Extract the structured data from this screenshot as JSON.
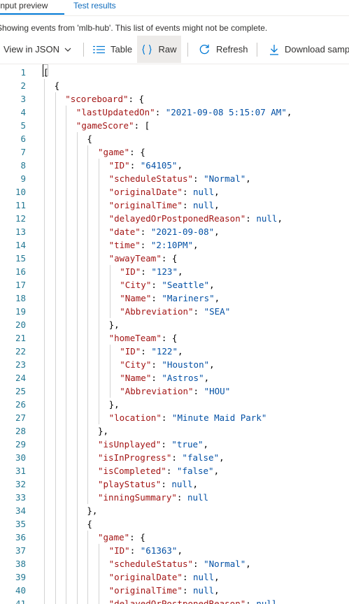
{
  "tabs": [
    {
      "label": "Input preview",
      "active": true
    },
    {
      "label": "Test results",
      "active": false
    }
  ],
  "notice": "Showing events from 'mlb-hub'. This list of events might not be complete.",
  "toolbar": {
    "view_label": "View in JSON",
    "table_label": "Table",
    "raw_label": "Raw",
    "refresh_label": "Refresh",
    "download_label": "Download samp"
  },
  "colors": {
    "accent": "#0078d4",
    "link": "#0f6cbd",
    "json_key": "#a31515",
    "json_value": "#0451a5",
    "line_number": "#237893"
  },
  "editor": {
    "lines": [
      {
        "n": "1",
        "indent": 0,
        "parts": [
          [
            "p",
            "["
          ]
        ]
      },
      {
        "n": "2",
        "indent": 1,
        "parts": [
          [
            "p",
            "{"
          ]
        ]
      },
      {
        "n": "3",
        "indent": 2,
        "parts": [
          [
            "k",
            "\"scoreboard\""
          ],
          [
            "p",
            ": {"
          ]
        ]
      },
      {
        "n": "4",
        "indent": 3,
        "parts": [
          [
            "k",
            "\"lastUpdatedOn\""
          ],
          [
            "p",
            ": "
          ],
          [
            "s",
            "\"2021-09-08 5:15:07 AM\""
          ],
          [
            "p",
            ","
          ]
        ]
      },
      {
        "n": "5",
        "indent": 3,
        "parts": [
          [
            "k",
            "\"gameScore\""
          ],
          [
            "p",
            ": ["
          ]
        ]
      },
      {
        "n": "6",
        "indent": 4,
        "parts": [
          [
            "p",
            "{"
          ]
        ]
      },
      {
        "n": "7",
        "indent": 5,
        "parts": [
          [
            "k",
            "\"game\""
          ],
          [
            "p",
            ": {"
          ]
        ]
      },
      {
        "n": "8",
        "indent": 6,
        "parts": [
          [
            "k",
            "\"ID\""
          ],
          [
            "p",
            ": "
          ],
          [
            "s",
            "\"64105\""
          ],
          [
            "p",
            ","
          ]
        ]
      },
      {
        "n": "9",
        "indent": 6,
        "parts": [
          [
            "k",
            "\"scheduleStatus\""
          ],
          [
            "p",
            ": "
          ],
          [
            "s",
            "\"Normal\""
          ],
          [
            "p",
            ","
          ]
        ]
      },
      {
        "n": "10",
        "indent": 6,
        "parts": [
          [
            "k",
            "\"originalDate\""
          ],
          [
            "p",
            ": "
          ],
          [
            "n",
            "null"
          ],
          [
            "p",
            ","
          ]
        ]
      },
      {
        "n": "11",
        "indent": 6,
        "parts": [
          [
            "k",
            "\"originalTime\""
          ],
          [
            "p",
            ": "
          ],
          [
            "n",
            "null"
          ],
          [
            "p",
            ","
          ]
        ]
      },
      {
        "n": "12",
        "indent": 6,
        "parts": [
          [
            "k",
            "\"delayedOrPostponedReason\""
          ],
          [
            "p",
            ": "
          ],
          [
            "n",
            "null"
          ],
          [
            "p",
            ","
          ]
        ]
      },
      {
        "n": "13",
        "indent": 6,
        "parts": [
          [
            "k",
            "\"date\""
          ],
          [
            "p",
            ": "
          ],
          [
            "s",
            "\"2021-09-08\""
          ],
          [
            "p",
            ","
          ]
        ]
      },
      {
        "n": "14",
        "indent": 6,
        "parts": [
          [
            "k",
            "\"time\""
          ],
          [
            "p",
            ": "
          ],
          [
            "s",
            "\"2:10PM\""
          ],
          [
            "p",
            ","
          ]
        ]
      },
      {
        "n": "15",
        "indent": 6,
        "parts": [
          [
            "k",
            "\"awayTeam\""
          ],
          [
            "p",
            ": {"
          ]
        ]
      },
      {
        "n": "16",
        "indent": 7,
        "parts": [
          [
            "k",
            "\"ID\""
          ],
          [
            "p",
            ": "
          ],
          [
            "s",
            "\"123\""
          ],
          [
            "p",
            ","
          ]
        ]
      },
      {
        "n": "17",
        "indent": 7,
        "parts": [
          [
            "k",
            "\"City\""
          ],
          [
            "p",
            ": "
          ],
          [
            "s",
            "\"Seattle\""
          ],
          [
            "p",
            ","
          ]
        ]
      },
      {
        "n": "18",
        "indent": 7,
        "parts": [
          [
            "k",
            "\"Name\""
          ],
          [
            "p",
            ": "
          ],
          [
            "s",
            "\"Mariners\""
          ],
          [
            "p",
            ","
          ]
        ]
      },
      {
        "n": "19",
        "indent": 7,
        "parts": [
          [
            "k",
            "\"Abbreviation\""
          ],
          [
            "p",
            ": "
          ],
          [
            "s",
            "\"SEA\""
          ]
        ]
      },
      {
        "n": "20",
        "indent": 6,
        "parts": [
          [
            "p",
            "},"
          ]
        ]
      },
      {
        "n": "21",
        "indent": 6,
        "parts": [
          [
            "k",
            "\"homeTeam\""
          ],
          [
            "p",
            ": {"
          ]
        ]
      },
      {
        "n": "22",
        "indent": 7,
        "parts": [
          [
            "k",
            "\"ID\""
          ],
          [
            "p",
            ": "
          ],
          [
            "s",
            "\"122\""
          ],
          [
            "p",
            ","
          ]
        ]
      },
      {
        "n": "23",
        "indent": 7,
        "parts": [
          [
            "k",
            "\"City\""
          ],
          [
            "p",
            ": "
          ],
          [
            "s",
            "\"Houston\""
          ],
          [
            "p",
            ","
          ]
        ]
      },
      {
        "n": "24",
        "indent": 7,
        "parts": [
          [
            "k",
            "\"Name\""
          ],
          [
            "p",
            ": "
          ],
          [
            "s",
            "\"Astros\""
          ],
          [
            "p",
            ","
          ]
        ]
      },
      {
        "n": "25",
        "indent": 7,
        "parts": [
          [
            "k",
            "\"Abbreviation\""
          ],
          [
            "p",
            ": "
          ],
          [
            "s",
            "\"HOU\""
          ]
        ]
      },
      {
        "n": "26",
        "indent": 6,
        "parts": [
          [
            "p",
            "},"
          ]
        ]
      },
      {
        "n": "27",
        "indent": 6,
        "parts": [
          [
            "k",
            "\"location\""
          ],
          [
            "p",
            ": "
          ],
          [
            "s",
            "\"Minute Maid Park\""
          ]
        ]
      },
      {
        "n": "28",
        "indent": 5,
        "parts": [
          [
            "p",
            "},"
          ]
        ]
      },
      {
        "n": "29",
        "indent": 5,
        "parts": [
          [
            "k",
            "\"isUnplayed\""
          ],
          [
            "p",
            ": "
          ],
          [
            "s",
            "\"true\""
          ],
          [
            "p",
            ","
          ]
        ]
      },
      {
        "n": "30",
        "indent": 5,
        "parts": [
          [
            "k",
            "\"isInProgress\""
          ],
          [
            "p",
            ": "
          ],
          [
            "s",
            "\"false\""
          ],
          [
            "p",
            ","
          ]
        ]
      },
      {
        "n": "31",
        "indent": 5,
        "parts": [
          [
            "k",
            "\"isCompleted\""
          ],
          [
            "p",
            ": "
          ],
          [
            "s",
            "\"false\""
          ],
          [
            "p",
            ","
          ]
        ]
      },
      {
        "n": "32",
        "indent": 5,
        "parts": [
          [
            "k",
            "\"playStatus\""
          ],
          [
            "p",
            ": "
          ],
          [
            "n",
            "null"
          ],
          [
            "p",
            ","
          ]
        ]
      },
      {
        "n": "33",
        "indent": 5,
        "parts": [
          [
            "k",
            "\"inningSummary\""
          ],
          [
            "p",
            ": "
          ],
          [
            "n",
            "null"
          ]
        ]
      },
      {
        "n": "34",
        "indent": 4,
        "parts": [
          [
            "p",
            "},"
          ]
        ]
      },
      {
        "n": "35",
        "indent": 4,
        "parts": [
          [
            "p",
            "{"
          ]
        ]
      },
      {
        "n": "36",
        "indent": 5,
        "parts": [
          [
            "k",
            "\"game\""
          ],
          [
            "p",
            ": {"
          ]
        ]
      },
      {
        "n": "37",
        "indent": 6,
        "parts": [
          [
            "k",
            "\"ID\""
          ],
          [
            "p",
            ": "
          ],
          [
            "s",
            "\"61363\""
          ],
          [
            "p",
            ","
          ]
        ]
      },
      {
        "n": "38",
        "indent": 6,
        "parts": [
          [
            "k",
            "\"scheduleStatus\""
          ],
          [
            "p",
            ": "
          ],
          [
            "s",
            "\"Normal\""
          ],
          [
            "p",
            ","
          ]
        ]
      },
      {
        "n": "39",
        "indent": 6,
        "parts": [
          [
            "k",
            "\"originalDate\""
          ],
          [
            "p",
            ": "
          ],
          [
            "n",
            "null"
          ],
          [
            "p",
            ","
          ]
        ]
      },
      {
        "n": "40",
        "indent": 6,
        "parts": [
          [
            "k",
            "\"originalTime\""
          ],
          [
            "p",
            ": "
          ],
          [
            "n",
            "null"
          ],
          [
            "p",
            ","
          ]
        ]
      },
      {
        "n": "41",
        "indent": 6,
        "parts": [
          [
            "k",
            "\"delayedOrPostponedReason\""
          ],
          [
            "p",
            ": "
          ],
          [
            "n",
            "null"
          ],
          [
            "p",
            ","
          ]
        ]
      }
    ]
  }
}
